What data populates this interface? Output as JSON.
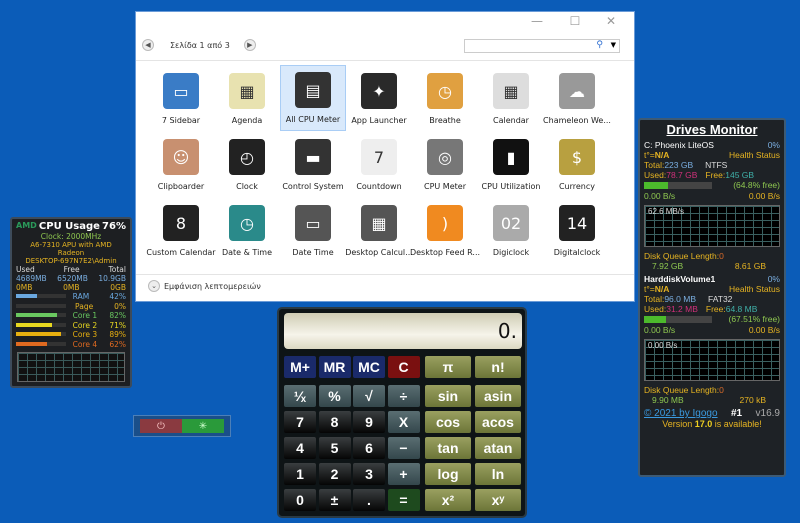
{
  "window": {
    "page_label": "Σελίδα 1 από 3",
    "search_value": "",
    "details_label": "Εμφάνιση λεπτομερειών",
    "minimize": "—",
    "maximize": "☐",
    "close": "✕"
  },
  "gadgets": [
    {
      "label": "7 Sidebar",
      "color": "#3a7cc6",
      "glyph": "▭"
    },
    {
      "label": "Agenda",
      "color": "#e8e2b0",
      "glyph": "▦"
    },
    {
      "label": "All CPU Meter",
      "color": "#333",
      "glyph": "▤",
      "selected": true
    },
    {
      "label": "App Launcher",
      "color": "#2a2a2a",
      "glyph": "✦"
    },
    {
      "label": "Breathe",
      "color": "#e0a040",
      "glyph": "◷"
    },
    {
      "label": "Calendar",
      "color": "#ddd",
      "glyph": "▦"
    },
    {
      "label": "Chameleon We...",
      "color": "#999",
      "glyph": "☁"
    },
    {
      "label": "Clipboarder",
      "color": "#c89070",
      "glyph": "☺"
    },
    {
      "label": "Clock",
      "color": "#222",
      "glyph": "◴"
    },
    {
      "label": "Control System",
      "color": "#333",
      "glyph": "▬"
    },
    {
      "label": "Countdown",
      "color": "#eee",
      "glyph": "7"
    },
    {
      "label": "CPU Meter",
      "color": "#777",
      "glyph": "◎"
    },
    {
      "label": "CPU Utilization",
      "color": "#111",
      "glyph": "▮"
    },
    {
      "label": "Currency",
      "color": "#b8a040",
      "glyph": "$"
    },
    {
      "label": "Custom Calendar",
      "color": "#222",
      "glyph": "8"
    },
    {
      "label": "Date & Time",
      "color": "#2a8a8a",
      "glyph": "◷"
    },
    {
      "label": "Date Time",
      "color": "#555",
      "glyph": "▭"
    },
    {
      "label": "Desktop Calcul...",
      "color": "#555",
      "glyph": "▦"
    },
    {
      "label": "Desktop Feed R...",
      "color": "#f08a20",
      "glyph": ")"
    },
    {
      "label": "Digiclock",
      "color": "#aaa",
      "glyph": "02"
    },
    {
      "label": "Digitalclock",
      "color": "#222",
      "glyph": "14"
    }
  ],
  "cpu": {
    "brand": "AMD",
    "title": "CPU Usage",
    "percent": "76%",
    "clock": "Clock: 2000MHz",
    "model": "A6-7310 APU with AMD Radeon",
    "user": "DESKTOP-697N7E2\\Admin",
    "headers": [
      "Used",
      "Free",
      "Total"
    ],
    "mem": [
      "4689MB",
      "6520MB",
      "10.9GB"
    ],
    "page": [
      "0MB",
      "0MB",
      "0GB"
    ],
    "bars": [
      {
        "label": "RAM",
        "value": "42%",
        "pct": 42,
        "color": "#6aa8e0"
      },
      {
        "label": "Page",
        "value": "0%",
        "pct": 0,
        "color": "#888"
      },
      {
        "label": "Core 1",
        "value": "82%",
        "pct": 82,
        "color": "#6ac860"
      },
      {
        "label": "Core 2",
        "value": "71%",
        "pct": 71,
        "color": "#e8d820"
      },
      {
        "label": "Core 3",
        "value": "89%",
        "pct": 89,
        "color": "#e8b010"
      },
      {
        "label": "Core 4",
        "value": "62%",
        "pct": 62,
        "color": "#e06a20"
      }
    ]
  },
  "power": {
    "power_icon": "⏻",
    "sleep_icon": "✳"
  },
  "calculator": {
    "display": "0.",
    "buttons": [
      [
        "M+",
        "MR",
        "MC",
        "C"
      ],
      [
        "¹⁄ₓ",
        "%",
        "√",
        "÷"
      ],
      [
        "7",
        "8",
        "9",
        "X"
      ],
      [
        "4",
        "5",
        "6",
        "−"
      ],
      [
        "1",
        "2",
        "3",
        "+"
      ],
      [
        "0",
        "±",
        ".",
        "="
      ]
    ],
    "sci": [
      [
        "π",
        "n!"
      ],
      [
        "sin",
        "asin"
      ],
      [
        "cos",
        "acos"
      ],
      [
        "tan",
        "atan"
      ],
      [
        "log",
        "ln"
      ],
      [
        "x²",
        "xʸ"
      ]
    ]
  },
  "drives": {
    "title": "Drives Monitor",
    "volumes": [
      {
        "name": "C: Phoenix LiteOS",
        "pct": "0%",
        "temp": "t°=",
        "temp_val": "N/A",
        "health": "Health Status",
        "total_label": "Total:",
        "total": "223 GB",
        "fs": "NTFS",
        "used_label": "Used:",
        "used": "78.7 GB",
        "free_label": "Free:",
        "free": "145 GB",
        "free_pct": "(64.8% free)",
        "fill": 35.2,
        "up": "0.00 B/s",
        "down": "0.00 B/s",
        "graph": "62.6 MB/s",
        "dql": "Disk Queue Length:",
        "dql_val": "0",
        "read": "7.92 GB",
        "write": "8.61 GB"
      },
      {
        "name": "HarddiskVolume1",
        "pct": "0%",
        "temp": "t°=",
        "temp_val": "N/A",
        "health": "Health Status",
        "total_label": "Total:",
        "total": "96.0 MB",
        "fs": "FAT32",
        "used_label": "Used:",
        "used": "31.2 MB",
        "free_label": "Free:",
        "free": "64.8 MB",
        "free_pct": "(67.51% free)",
        "fill": 32.5,
        "up": "0.00 B/s",
        "down": "0.00 B/s",
        "graph": "0.00 B/s",
        "dql": "Disk Queue Length:",
        "dql_val": "0",
        "read": "9.90 MB",
        "write": "270 kB"
      }
    ],
    "copyright": "© 2021 by Igogo",
    "rank": "#1",
    "version": "v16.9",
    "update_pre": "Version ",
    "update_ver": "17.0",
    "update_post": " is available!"
  }
}
